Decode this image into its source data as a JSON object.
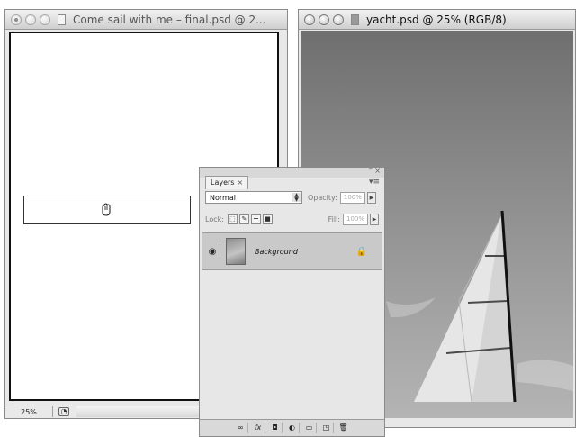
{
  "left_window": {
    "title": "Come sail with me – final.psd @ 2...",
    "zoom": "25%"
  },
  "right_window": {
    "title": "yacht.psd @ 25% (RGB/8)"
  },
  "layers_panel": {
    "tab_label": "Layers",
    "tab_close": "×",
    "blend_mode": "Normal",
    "opacity_label": "Opacity:",
    "opacity_value": "100%",
    "lock_label": "Lock:",
    "fill_label": "Fill:",
    "fill_value": "100%",
    "layer_name": "Background",
    "bottom_buttons": [
      "link-layers",
      "fx",
      "mask",
      "adjustment",
      "group",
      "new-layer",
      "delete"
    ]
  },
  "icons": {
    "cursor": "grab-hand-icon",
    "eye": "eye-icon",
    "lock": "lock-icon"
  }
}
